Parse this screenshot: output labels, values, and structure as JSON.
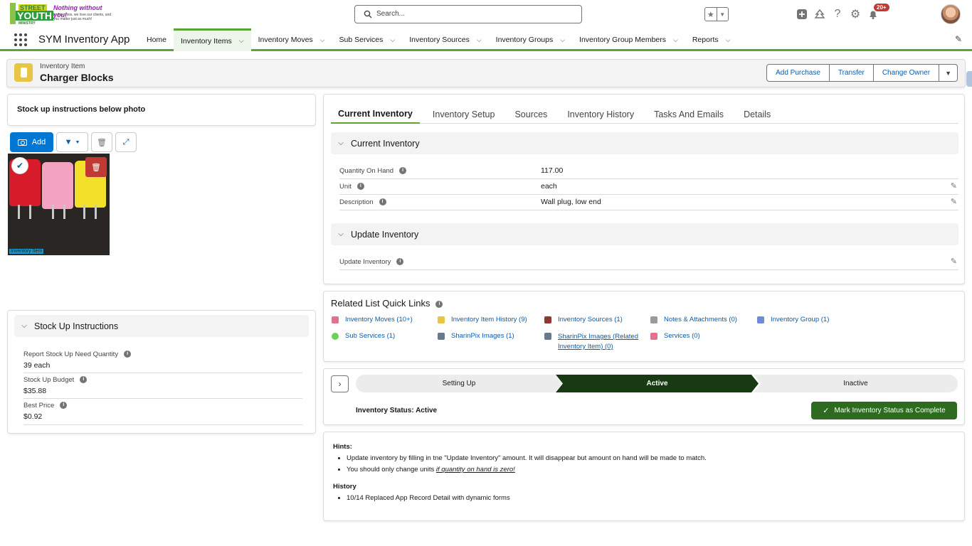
{
  "brand": {
    "logo_line1": "STREET",
    "logo_line2": "YOUTH",
    "logo_line3": "MINISTRY",
    "tagline": "Nothing without you!",
    "tagline_sub": "In this crisis, we love our clients, and you matter just as much!"
  },
  "search": {
    "placeholder": "Search..."
  },
  "header": {
    "notification_count": "20+",
    "icons": [
      "favorites-star-icon",
      "add-icon",
      "trailhead-icon",
      "help-icon",
      "setup-gear-icon",
      "bell-icon"
    ]
  },
  "nav": {
    "app_name": "SYM Inventory App",
    "items": [
      {
        "label": "Home",
        "has_menu": false
      },
      {
        "label": "Inventory Items",
        "has_menu": true,
        "active": true
      },
      {
        "label": "Inventory Moves",
        "has_menu": true
      },
      {
        "label": "Sub Services",
        "has_menu": true
      },
      {
        "label": "Inventory Sources",
        "has_menu": true
      },
      {
        "label": "Inventory Groups",
        "has_menu": true
      },
      {
        "label": "Inventory Group Members",
        "has_menu": true
      },
      {
        "label": "Reports",
        "has_menu": true
      }
    ]
  },
  "record": {
    "object_label": "Inventory Item",
    "title": "Charger Blocks",
    "actions": [
      "Add Purchase",
      "Transfer",
      "Change Owner"
    ]
  },
  "left": {
    "instructions_title": "Stock up instructions below photo",
    "add_label": "Add",
    "photo_tag": "Inventory Item",
    "stockup": {
      "section_title": "Stock Up Instructions",
      "fields": [
        {
          "label": "Report Stock Up Need Quantity",
          "value": "39 each"
        },
        {
          "label": "Stock Up Budget",
          "value": "$35.88"
        },
        {
          "label": "Best Price",
          "value": "$0.92"
        }
      ]
    }
  },
  "tabs": [
    "Current Inventory",
    "Inventory Setup",
    "Sources",
    "Inventory History",
    "Tasks And Emails",
    "Details"
  ],
  "current_inventory": {
    "section_title": "Current Inventory",
    "rows": [
      {
        "label": "Quantity On Hand",
        "value": "117.00"
      },
      {
        "label": "Unit",
        "value": "each"
      },
      {
        "label": "Description",
        "value": "Wall plug, low end"
      }
    ]
  },
  "update_inventory": {
    "section_title": "Update Inventory",
    "field_label": "Update Inventory"
  },
  "quick_links": {
    "title": "Related List Quick Links",
    "items": [
      {
        "label": "Inventory Moves (10+)",
        "color": "#e3708f"
      },
      {
        "label": "Inventory Item History (9)",
        "color": "#e8c545"
      },
      {
        "label": "Inventory Sources (1)",
        "color": "#8a3a2e"
      },
      {
        "label": "Notes & Attachments (0)",
        "color": "#9a9a9a"
      },
      {
        "label": "Inventory Group (1)",
        "color": "#6d8bd8"
      },
      {
        "label": "Sub Services (1)",
        "color": "#6fcf5a"
      },
      {
        "label": "SharinPix Images (1)",
        "color": "#6a7a8c"
      },
      {
        "label": "SharinPix Images (Related Inventory Item) (0)",
        "color": "#6a7a8c"
      },
      {
        "label": "Services (0)",
        "color": "#e3708f"
      }
    ]
  },
  "path": {
    "stages": [
      "Setting Up",
      "Active",
      "Inactive"
    ],
    "current_stage": "Active",
    "status_text": "Inventory Status: Active",
    "complete_label": "Mark Inventory Status as Complete"
  },
  "hints": {
    "hints_title": "Hints:",
    "hint1": "Update inventory by filling in tne \"Update Inventory\" amount. It will disappear but amount on hand will be made to match.",
    "hint2_prefix": "You should only change units ",
    "hint2_em": "if quantity on hand is zero!",
    "history_title": "History",
    "history1": "10/14 Replaced App Record Detail with dynamic forms"
  },
  "colors": {
    "accent_green": "#5ba43a",
    "path_active": "#173a13",
    "primary_blue": "#0176d3"
  }
}
